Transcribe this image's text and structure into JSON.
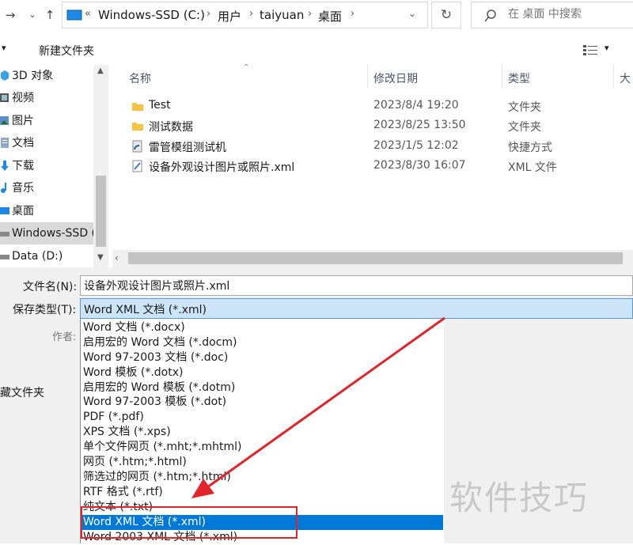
{
  "address_bar": {
    "chevron": "«",
    "breadcrumbs": [
      "Windows-SSD (C:)",
      "用户",
      "taiyuan",
      "桌面"
    ],
    "search_placeholder": "在 桌面 中搜索"
  },
  "toolbar": {
    "organize_label": "▾",
    "new_folder_label": "新建文件夹"
  },
  "nav_pane": {
    "items": [
      {
        "label": "3D 对象",
        "icon": "3d-objects-icon"
      },
      {
        "label": "视频",
        "icon": "video-icon"
      },
      {
        "label": "图片",
        "icon": "pictures-icon"
      },
      {
        "label": "文档",
        "icon": "documents-icon"
      },
      {
        "label": "下载",
        "icon": "download-icon"
      },
      {
        "label": "音乐",
        "icon": "music-icon"
      },
      {
        "label": "桌面",
        "icon": "desktop-icon"
      },
      {
        "label": "Windows-SSD (",
        "icon": "drive-icon",
        "selected": true
      },
      {
        "label": "Data (D:)",
        "icon": "drive-icon"
      }
    ]
  },
  "file_list": {
    "columns": [
      "名称",
      "修改日期",
      "类型",
      "大"
    ],
    "rows": [
      {
        "name": "Test",
        "date": "2023/8/4 19:20",
        "type": "文件夹",
        "icon": "folder-icon"
      },
      {
        "name": "测试数据",
        "date": "2023/8/25 13:50",
        "type": "文件夹",
        "icon": "folder-icon"
      },
      {
        "name": "雷管模组测试机",
        "date": "2023/1/5 12:02",
        "type": "快捷方式",
        "icon": "shortcut-icon"
      },
      {
        "name": "设备外观设计图片或照片.xml",
        "date": "2023/8/30 16:07",
        "type": "XML 文件",
        "icon": "xml-file-icon"
      }
    ]
  },
  "form": {
    "filename_label": "文件名(N):",
    "filename_value": "设备外观设计图片或照片.xml",
    "savetype_label": "保存类型(T):",
    "savetype_value": "Word XML 文档 (*.xml)",
    "author_label": "作者:",
    "hide_folders_label": "藏文件夹"
  },
  "save_type_options": [
    "Word 文档 (*.docx)",
    "启用宏的 Word 文档 (*.docm)",
    "Word 97-2003 文档 (*.doc)",
    "Word 模板 (*.dotx)",
    "启用宏的 Word 模板 (*.dotm)",
    "Word 97-2003 模板 (*.dot)",
    "PDF (*.pdf)",
    "XPS 文档 (*.xps)",
    "单个文件网页 (*.mht;*.mhtml)",
    "网页 (*.htm;*.html)",
    "筛选过的网页 (*.htm;*.html)",
    "RTF 格式 (*.rtf)",
    "纯文本 (*.txt)",
    "Word XML 文档 (*.xml)",
    "Word 2003 XML 文档 (*.xml)"
  ],
  "highlighted_option": "Word XML 文档 (*.xml)",
  "watermark": "软件技巧",
  "colors": {
    "selection_blue": "#0078d7",
    "annotation_red": "#e0242a",
    "folder_yellow": "#f5c342"
  }
}
